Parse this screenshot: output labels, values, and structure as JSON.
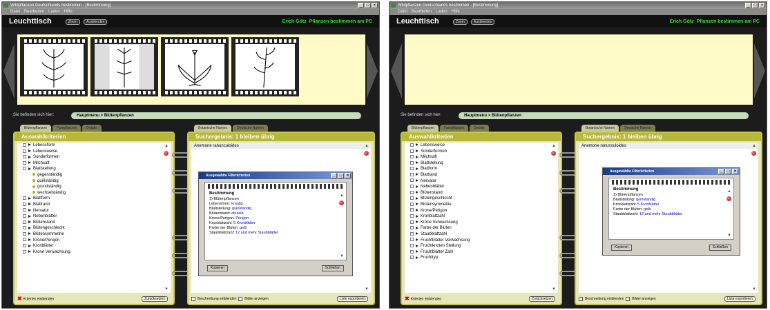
{
  "app_title": "Wildpflanzen Deutschlands bestimmen - [Bestimmung]",
  "menu": [
    "Datei",
    "Bearbeiten",
    "Laden",
    "Hilfe"
  ],
  "header": {
    "title": "Leuchttisch",
    "zoom_label": "Zoom",
    "hide_label": "Ausblenden",
    "author": "Erich Götz",
    "product": "Pflanzen bestimmen am PC"
  },
  "breadcrumb": {
    "prefix": "Sie befinden sich hier:",
    "path": "Hauptmenu > Blütenpflanzen"
  },
  "left_tabs": [
    "Blütenpflanzen",
    "Farnpflanzen",
    "Details"
  ],
  "right_tabs": [
    "Botanische Namen",
    "Deutsche Namen"
  ],
  "criteria_title": "Auswahlkriterien",
  "results_title": "Suchergebnis: 1 bleiben übrig",
  "result_item": "Anemone ranunculoides",
  "criteria_left": [
    {
      "label": "Lebensform",
      "type": "item"
    },
    {
      "label": "Lebensweise",
      "type": "item"
    },
    {
      "label": "Sonderformen",
      "type": "item"
    },
    {
      "label": "Milchsaft",
      "type": "item"
    },
    {
      "label": "Blattstellung",
      "type": "open"
    },
    {
      "label": "gegenständig",
      "type": "sub"
    },
    {
      "label": "quirlständig",
      "type": "sub"
    },
    {
      "label": "grundständig",
      "type": "sub"
    },
    {
      "label": "wechselständig",
      "type": "sub"
    },
    {
      "label": "Blattform",
      "type": "item"
    },
    {
      "label": "Blattrand",
      "type": "item"
    },
    {
      "label": "Nervatur",
      "type": "item"
    },
    {
      "label": "Nebenblätter",
      "type": "item"
    },
    {
      "label": "Blütenstand",
      "type": "item"
    },
    {
      "label": "Blütengeschlecht",
      "type": "item"
    },
    {
      "label": "Blütensymmetrie",
      "type": "item"
    },
    {
      "label": "Krone/Perigon",
      "type": "item"
    },
    {
      "label": "Kronblätter",
      "type": "item"
    },
    {
      "label": "Krone Verwachsung",
      "type": "item"
    }
  ],
  "criteria_right": [
    "Lebensweise",
    "Sonderformen",
    "Milchsaft",
    "Blattstellung",
    "Blattform",
    "Blattrand",
    "Nervatur",
    "Nebenblätter",
    "Blütenstand",
    "Blütengeschlecht",
    "Blütensymmetrie",
    "Krone/Perigon",
    "Kronblattzahl",
    "Krone Verwachsung",
    "Farbe der Blüten",
    "Staubblattzahl",
    "Fruchtblätter Verwachsung",
    "Fruchtknoten Stellung",
    "Fruchtblätter Zahl",
    "Fruchttyp"
  ],
  "footer_left": {
    "kriterien": "Kriterien einblenden",
    "reset": "Zurücksetzen"
  },
  "footer_right": {
    "beschreibung": "Beschreibung einblenden",
    "bilder": "Bilder anzeigen",
    "export": "Liste exportieren"
  },
  "dialog": {
    "title": "Ausgewählte Filterkriterien",
    "heading": "Bestimmung",
    "lines": [
      {
        "k": "1) Blütenpflanzen",
        "v": ""
      },
      {
        "k": "Lebensform:",
        "v": "krautig"
      },
      {
        "k": "Blattstellung:",
        "v": "quirlständig"
      },
      {
        "k": "Blütenstand:",
        "v": "einzeln"
      },
      {
        "k": "Krone/Perigon:",
        "v": "Perigon"
      },
      {
        "k": "Kronblattzahl:",
        "v": "5 Kronblätter"
      },
      {
        "k": "Farbe der Blüten:",
        "v": "gelb"
      },
      {
        "k": "Staubblattzahl:",
        "v": "12 und mehr Staubblätter"
      }
    ],
    "lines_right": [
      {
        "k": "1) Blütenpflanzen",
        "v": ""
      },
      {
        "k": "Blattstellung:",
        "v": "quirlständig"
      },
      {
        "k": "Kronblattzahl:",
        "v": "5 Kronblätter"
      },
      {
        "k": "Farbe der Blüten:",
        "v": "gelb"
      },
      {
        "k": "Staubblattzahl:",
        "v": "12 und mehr Staubblätter"
      }
    ],
    "copy": "Kopieren",
    "close": "Schließen"
  },
  "colors": {
    "accent_green": "#33dd33",
    "panel_olive": "#b7b73b",
    "lightbox": "#fffac8"
  }
}
